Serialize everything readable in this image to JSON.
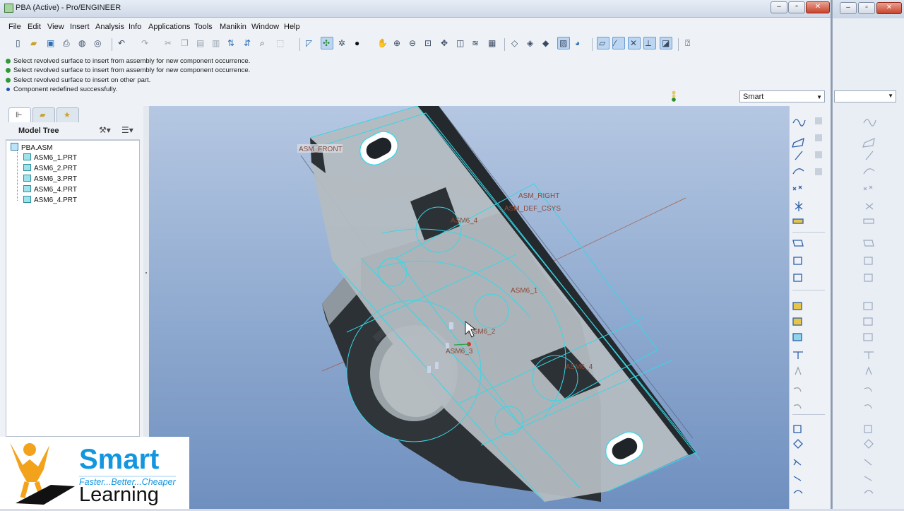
{
  "window": {
    "title": "PBA (Active) - Pro/ENGINEER",
    "controls": [
      "–",
      "▫",
      "✕"
    ]
  },
  "menu": [
    "File",
    "Edit",
    "View",
    "Insert",
    "Analysis",
    "Info",
    "Applications",
    "Tools",
    "Manikin",
    "Window",
    "Help"
  ],
  "messages": [
    {
      "kind": "ok",
      "text": "Select revolved surface to insert from assembly for new component occurrence."
    },
    {
      "kind": "ok",
      "text": "Select revolved surface to insert from assembly for new component occurrence."
    },
    {
      "kind": "ok",
      "text": "Select revolved surface to insert on other part."
    },
    {
      "kind": "info",
      "text": "Component redefined successfully."
    }
  ],
  "filter": {
    "value": "Smart"
  },
  "model_tree": {
    "header": "Model Tree",
    "root": "PBA.ASM",
    "items": [
      "ASM6_1.PRT",
      "ASM6_2.PRT",
      "ASM6_3.PRT",
      "ASM6_4.PRT",
      "ASM6_4.PRT"
    ]
  },
  "viewport_labels": {
    "front": "ASM_FRONT",
    "right": "ASM_RIGHT",
    "csys": "ASM_DEF_CSYS",
    "c1": "ASM6_1",
    "c2": "ASM6_2",
    "c3": "ASM6_3",
    "c4a": "ASM6_4",
    "c4b": "ASM6_4"
  },
  "logo": {
    "brand": "Smart",
    "tagline": "Faster...Better...Cheaper",
    "word": "Learning"
  },
  "colors": {
    "viewport_top": "#b5c7e2",
    "viewport_bottom": "#6f8fbf",
    "edge": "#37d6e6",
    "body_dark": "#2b3134",
    "body_light": "#aab3b8",
    "brand": "#1296e0"
  }
}
